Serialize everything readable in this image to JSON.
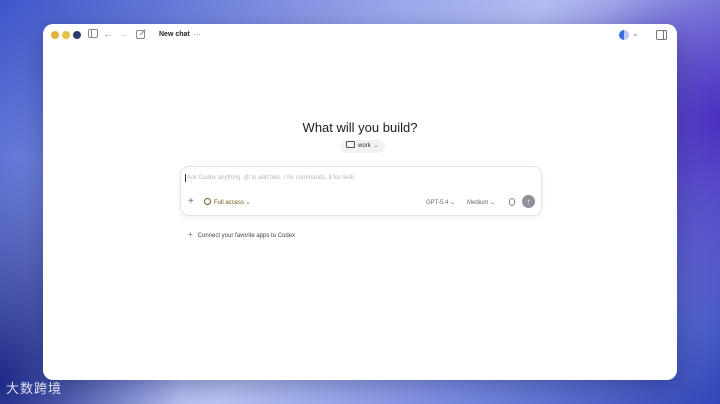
{
  "window": {
    "title": "New chat",
    "more": "…"
  },
  "main": {
    "heading": "What will you build?",
    "workspace": "work"
  },
  "composer": {
    "placeholder": "Ask Codex anything. @ to add files, / for commands, $ for skills",
    "access_label": "Full access",
    "model_label": "GPT-5.4",
    "effort_label": "Medium"
  },
  "connect_label": "Connect your favorite apps to Codex",
  "watermark": "大数跨境",
  "colors": {
    "accent_access": "#7a5a16",
    "send_button": "#8e9199"
  },
  "icons": [
    "sidebar-toggle-icon",
    "back-arrow-icon",
    "forward-arrow-icon",
    "new-chat-icon",
    "folder-icon",
    "plus-icon",
    "shield-icon",
    "microphone-icon",
    "send-arrow-icon"
  ]
}
